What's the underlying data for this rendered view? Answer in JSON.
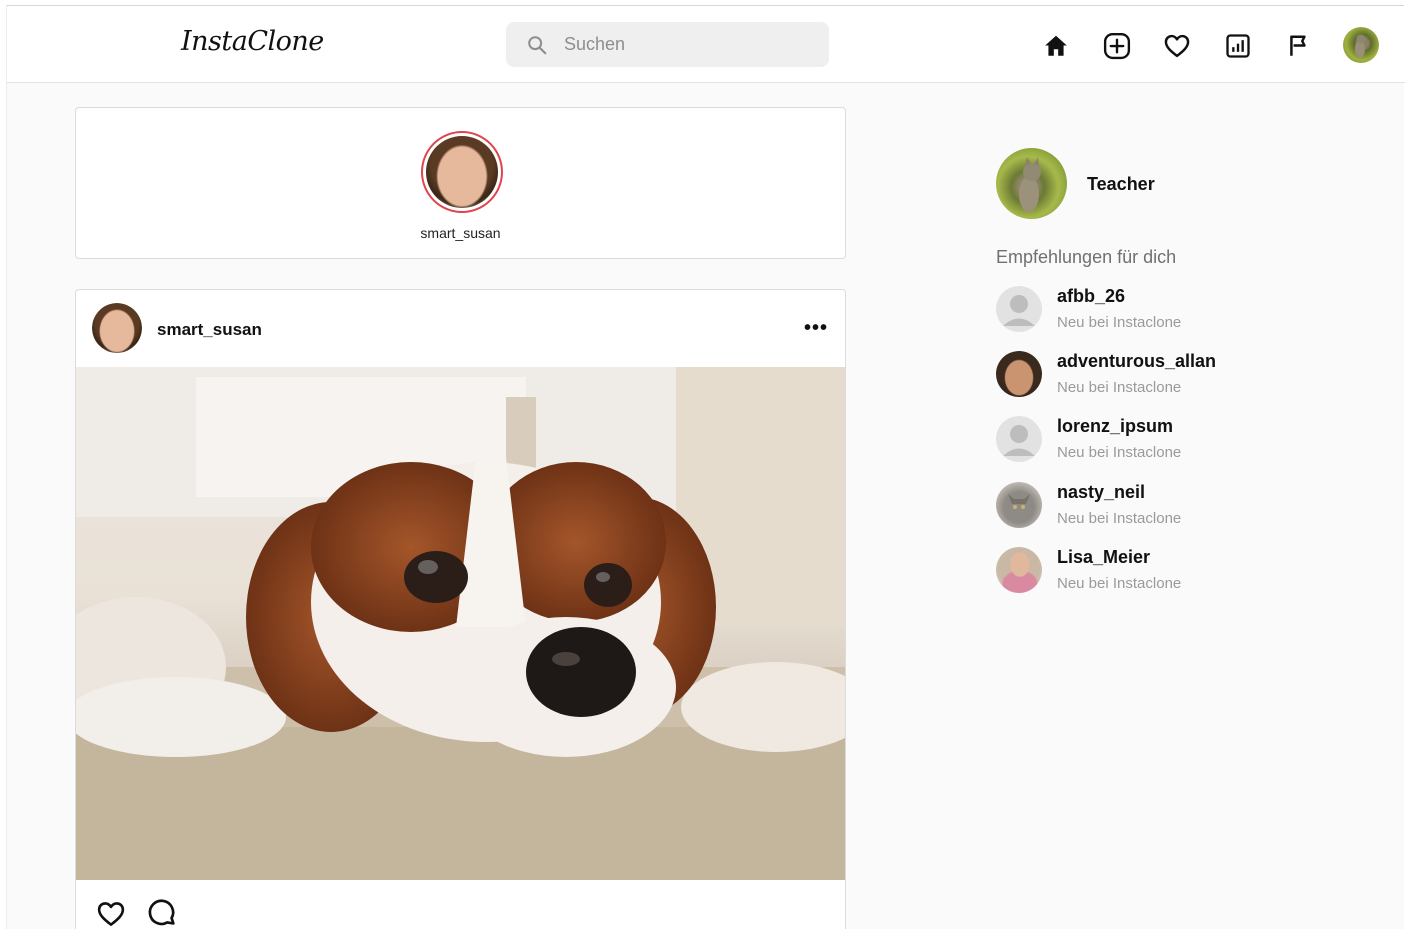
{
  "header": {
    "logo": "InstaClone",
    "search_placeholder": "Suchen",
    "nav_icons": [
      "home-icon",
      "add-post-icon",
      "heart-icon",
      "stats-icon",
      "flag-icon",
      "profile-avatar"
    ]
  },
  "stories": [
    {
      "username": "smart_susan"
    }
  ],
  "post": {
    "username": "smart_susan",
    "image": "Cavalier King Charles spaniel puppy lying on a carpet",
    "actions": [
      "heart-icon",
      "comment-icon"
    ]
  },
  "sidebar": {
    "me": {
      "name": "Teacher"
    },
    "recommendations_title": "Empfehlungen für dich",
    "recommendations": [
      {
        "username": "afbb_26",
        "subtitle": "Neu bei Instaclone"
      },
      {
        "username": "adventurous_allan",
        "subtitle": "Neu bei Instaclone"
      },
      {
        "username": "lorenz_ipsum",
        "subtitle": "Neu bei Instaclone"
      },
      {
        "username": "nasty_neil",
        "subtitle": "Neu bei Instaclone"
      },
      {
        "username": "Lisa_Meier",
        "subtitle": "Neu bei Instaclone"
      }
    ]
  },
  "colors": {
    "story_ring": "#e0444e",
    "page_background": "#fafafa",
    "muted_text": "#9a9a9a"
  }
}
